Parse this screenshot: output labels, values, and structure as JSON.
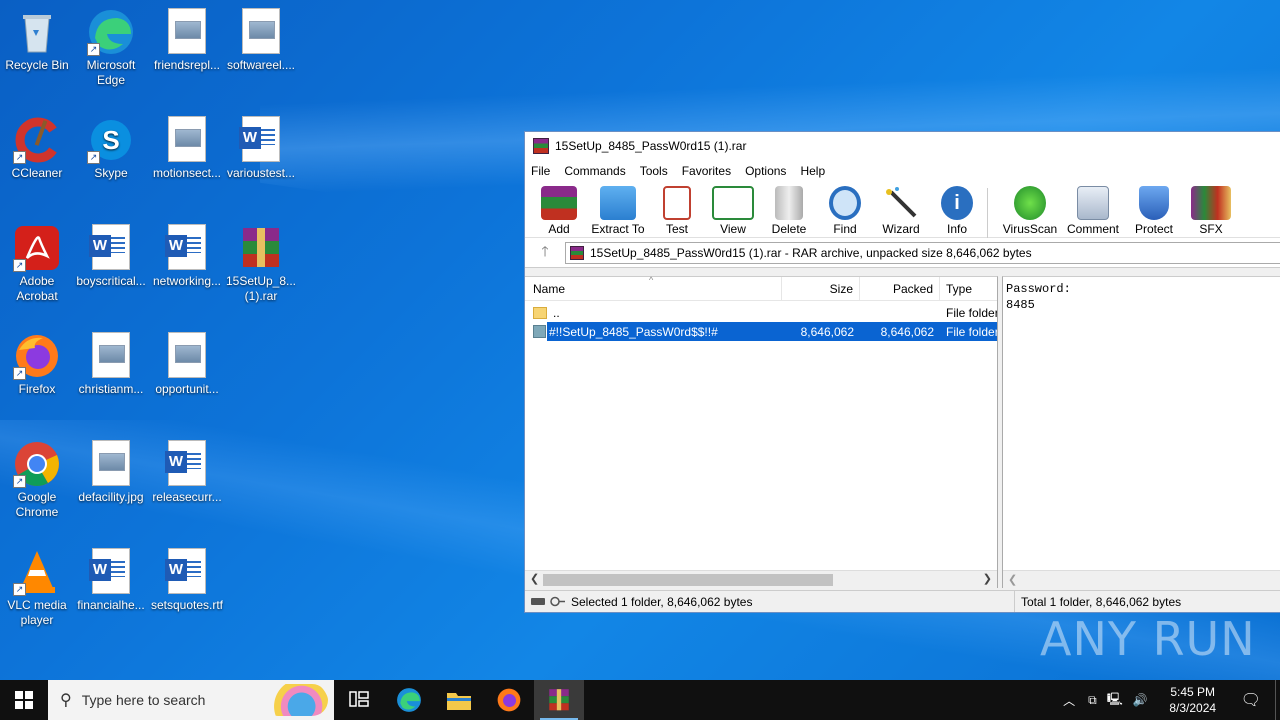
{
  "desktop": {
    "icons": [
      {
        "label": "Recycle Bin"
      },
      {
        "label": "Microsoft Edge"
      },
      {
        "label": "friendsrepl..."
      },
      {
        "label": "softwareel...."
      },
      {
        "label": "CCleaner"
      },
      {
        "label": "Skype"
      },
      {
        "label": "motionsect..."
      },
      {
        "label": "varioustest..."
      },
      {
        "label": "Adobe Acrobat"
      },
      {
        "label": "boyscritical..."
      },
      {
        "label": "networking..."
      },
      {
        "label": "15SetUp_8... (1).rar"
      },
      {
        "label": "Firefox"
      },
      {
        "label": "christianm..."
      },
      {
        "label": "opportunit..."
      },
      {
        "label": "Google Chrome"
      },
      {
        "label": "defacility.jpg"
      },
      {
        "label": "releasecurr..."
      },
      {
        "label": "VLC media player"
      },
      {
        "label": "financialhe..."
      },
      {
        "label": "setsquotes.rtf"
      }
    ]
  },
  "window": {
    "title": "15SetUp_8485_PassW0rd15 (1).rar",
    "menu": [
      "File",
      "Commands",
      "Tools",
      "Favorites",
      "Options",
      "Help"
    ],
    "toolbar": [
      "Add",
      "Extract To",
      "Test",
      "View",
      "Delete",
      "Find",
      "Wizard",
      "Info",
      "VirusScan",
      "Comment",
      "Protect",
      "SFX"
    ],
    "address": "15SetUp_8485_PassW0rd15 (1).rar - RAR archive, unpacked size 8,646,062 bytes",
    "columns": {
      "name": "Name",
      "size": "Size",
      "packed": "Packed",
      "type": "Type"
    },
    "rows": [
      {
        "name": "..",
        "size": "",
        "packed": "",
        "type": "File folder"
      },
      {
        "name": "#!!SetUp_8485_PassW0rd$$!!#",
        "size": "8,646,062",
        "packed": "8,646,062",
        "type": "File folder"
      }
    ],
    "comment": {
      "line1": "Password:",
      "line2": "8485"
    },
    "status_left": "Selected 1 folder, 8,646,062 bytes",
    "status_right": "Total 1 folder, 8,646,062 bytes"
  },
  "taskbar": {
    "search_placeholder": "Type here to search",
    "time": "5:45 PM",
    "date": "8/3/2024"
  },
  "watermark": "ANY RUN"
}
